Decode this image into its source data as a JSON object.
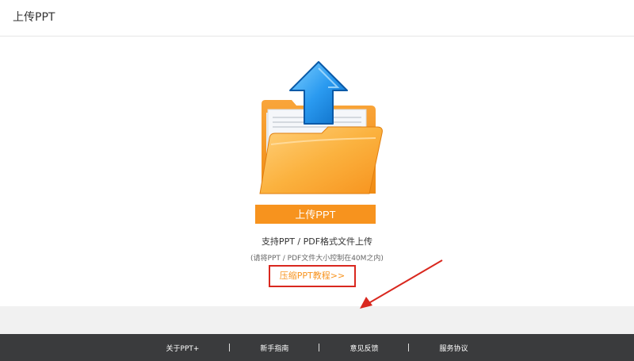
{
  "header": {
    "title": "上传PPT"
  },
  "upload": {
    "button_label": "上传PPT",
    "support_text": "支持PPT / PDF格式文件上传",
    "size_text": "(请将PPT / PDF文件大小控制在40M之内)",
    "tutorial_link": "压缩PPT教程>>"
  },
  "colors": {
    "accent": "#f7931e",
    "annotation_red": "#d9281f",
    "footer_bg": "#3a3b3d",
    "arrow_blue": "#1a7fd8"
  },
  "icons": {
    "illustration": "folder-upload-icon",
    "annotation": "red-arrow-icon"
  },
  "footer": {
    "links": [
      "关于PPT+",
      "新手指南",
      "意见反馈",
      "服务协议"
    ]
  }
}
